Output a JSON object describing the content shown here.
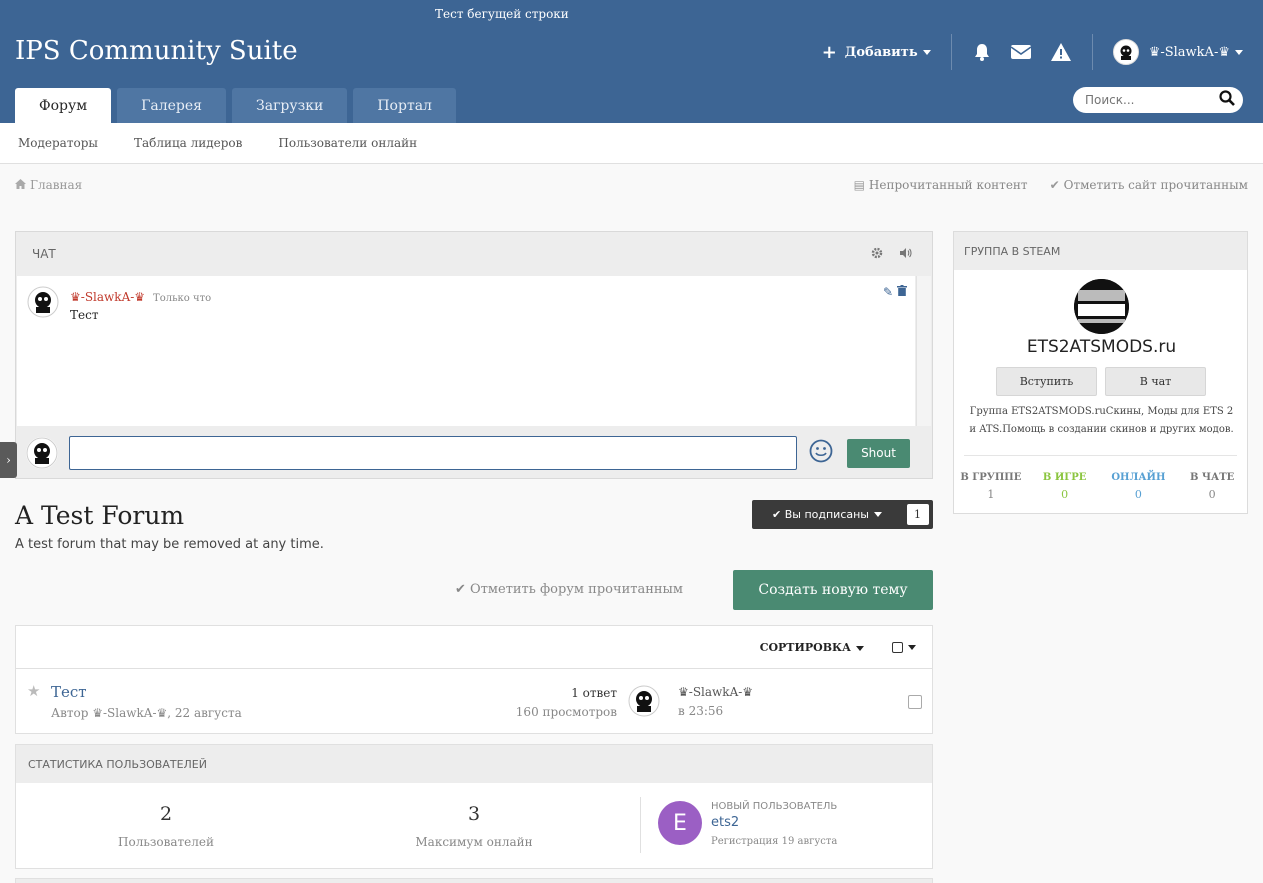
{
  "header": {
    "marquee": "Тест бегущей строки",
    "site_title": "IPS Community Suite",
    "add_label": "Добавить",
    "username": "♛-SlawkA-♛",
    "tabs": [
      {
        "label": "Форум",
        "active": true
      },
      {
        "label": "Галерея"
      },
      {
        "label": "Загрузки"
      },
      {
        "label": "Портал"
      }
    ],
    "search_placeholder": "Поиск..."
  },
  "subnav": {
    "items": [
      "Модераторы",
      "Таблица лидеров",
      "Пользователи онлайн"
    ]
  },
  "breadcrumb": {
    "home": "Главная"
  },
  "quick_links": {
    "unread": "Непрочитанный контент",
    "mark_site": "Отметить сайт прочитанным"
  },
  "chat": {
    "title": "ЧАТ",
    "messages": [
      {
        "author": "♛-SlawkA-♛",
        "time": "Только что",
        "text": "Тест"
      }
    ],
    "shout_label": "Shout",
    "input_value": ""
  },
  "forum": {
    "title": "A Test Forum",
    "description": "A test forum that may be removed at any time.",
    "follow_label": "Вы подписаны",
    "follow_count": "1",
    "mark_read": "Отметить форум прочитанным",
    "new_topic": "Создать новую тему",
    "sort_label": "СОРТИРОВКА"
  },
  "topics": [
    {
      "title": "Тест",
      "meta": "Автор ♛-SlawkA-♛, 22 августа",
      "replies": "1 ответ",
      "views": "160 просмотров",
      "last_author": "♛-SlawkA-♛",
      "last_time": "в 23:56"
    }
  ],
  "stats": {
    "title": "СТАТИСТИКА ПОЛЬЗОВАТЕЛЕЙ",
    "users_num": "2",
    "users_label": "Пользователей",
    "max_num": "3",
    "max_label": "Максимум онлайн",
    "newest_heading": "НОВЫЙ ПОЛЬЗОВАТЕЛЬ",
    "newest_initial": "E",
    "newest_name": "ets2",
    "newest_reg": "Регистрация 19 августа"
  },
  "steam": {
    "title": "ГРУППА В STEAM",
    "logo_text": "ETS2ATS MODS.RU",
    "name": "ETS2ATSMODS.ru",
    "join_label": "Вступить",
    "chat_label": "В чат",
    "description": "Группа ETS2ATSMODS.ruСкины, Моды для ETS 2 и ATS.Помощь в создании скинов и других модов.",
    "stats": [
      {
        "label": "В ГРУППЕ",
        "value": "1",
        "color": "#777777"
      },
      {
        "label": "В ИГРЕ",
        "value": "0",
        "color": "#8bc53f"
      },
      {
        "label": "ОНЛАЙН",
        "value": "0",
        "color": "#57a0d3"
      },
      {
        "label": "В ЧАТЕ",
        "value": "0",
        "color": "#777777"
      }
    ]
  },
  "colors": {
    "header": "#3d6594",
    "accent_green": "#4a8a72",
    "username_red": "#c0392b"
  }
}
